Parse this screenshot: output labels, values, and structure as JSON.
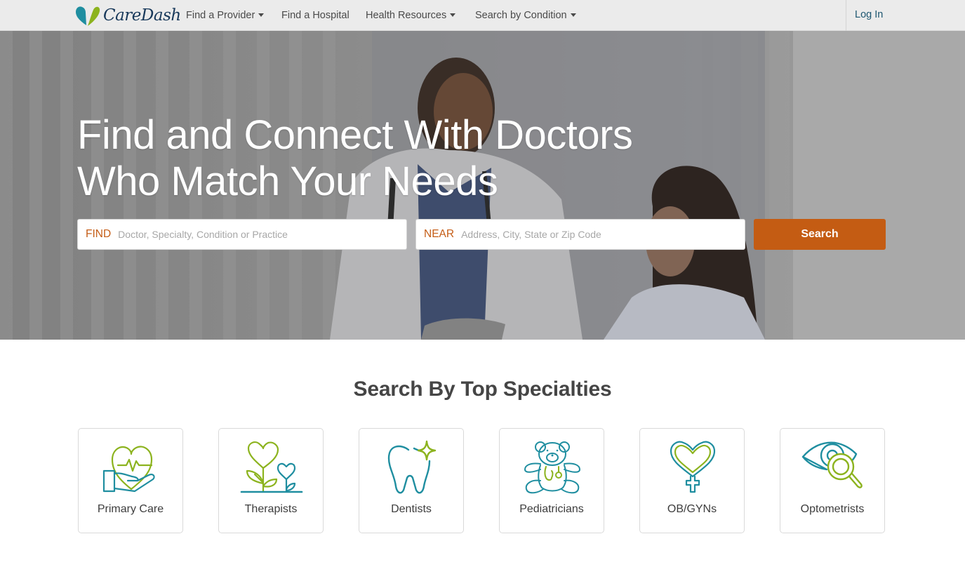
{
  "brand": {
    "name": "CareDash",
    "colors": {
      "teal": "#1f8ea0",
      "green": "#8cb31e",
      "navy": "#17385a",
      "accent_orange": "#c45c13"
    }
  },
  "nav": {
    "items": [
      {
        "label": "Find a Provider",
        "has_dropdown": true
      },
      {
        "label": "Find a Hospital",
        "has_dropdown": false
      },
      {
        "label": "Health Resources",
        "has_dropdown": true
      },
      {
        "label": "Search by Condition",
        "has_dropdown": true
      }
    ],
    "login_label": "Log In"
  },
  "hero": {
    "title_line1": "Find and Connect With Doctors",
    "title_line2": "Who Match Your Needs",
    "find": {
      "label": "FIND",
      "placeholder": "Doctor, Specialty, Condition or Practice",
      "value": ""
    },
    "near": {
      "label": "NEAR",
      "placeholder": "Address, City, State or Zip Code",
      "value": ""
    },
    "search_button": "Search"
  },
  "specialties": {
    "title": "Search By Top Specialties",
    "items": [
      {
        "label": "Primary Care",
        "icon": "heart-in-hand-icon"
      },
      {
        "label": "Therapists",
        "icon": "heart-flowers-icon"
      },
      {
        "label": "Dentists",
        "icon": "sparkling-tooth-icon"
      },
      {
        "label": "Pediatricians",
        "icon": "teddy-bear-icon"
      },
      {
        "label": "OB/GYNs",
        "icon": "heart-female-symbol-icon"
      },
      {
        "label": "Optometrists",
        "icon": "eye-magnifier-icon"
      }
    ]
  }
}
